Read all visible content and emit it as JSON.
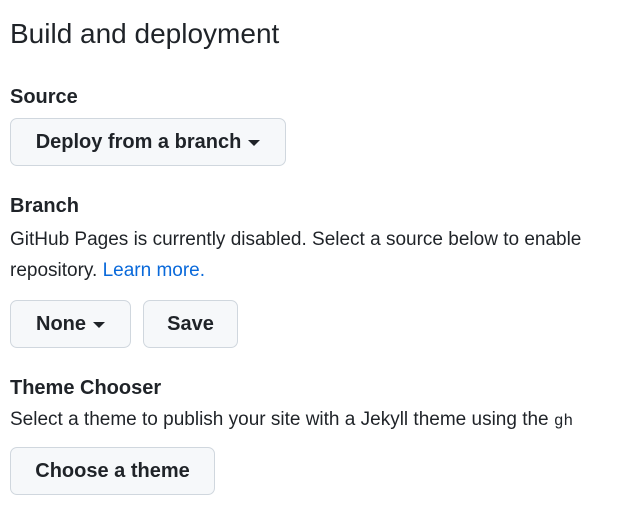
{
  "section": {
    "title": "Build and deployment"
  },
  "source": {
    "label": "Source",
    "dropdown_label": "Deploy from a branch"
  },
  "branch": {
    "label": "Branch",
    "description_line1": "GitHub Pages is currently disabled. Select a source below to enable",
    "description_line2": "repository.",
    "learn_more": "Learn more.",
    "dropdown_label": "None",
    "save_label": "Save"
  },
  "theme": {
    "label": "Theme Chooser",
    "description": "Select a theme to publish your site with a Jekyll theme using the ",
    "description_code": "gh",
    "button_label": "Choose a theme"
  },
  "icons": {
    "dropdown": "triangle-down-icon"
  },
  "colors": {
    "text": "#1f2328",
    "link": "#0969da",
    "button_bg": "#f6f8fa",
    "button_border": "#d0d7de"
  }
}
